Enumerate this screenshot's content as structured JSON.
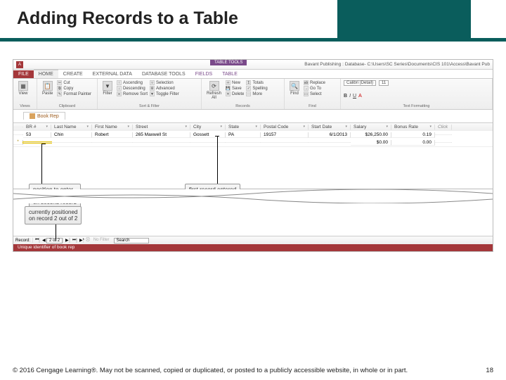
{
  "slide": {
    "title": "Adding Records to a Table"
  },
  "titlebar": {
    "tool_tabs": "TABLE TOOLS",
    "text": "Bavant Publishing : Database- C:\\Users\\SC Series\\Documents\\CIS 101\\Access\\Bavant Pub"
  },
  "tabs": {
    "file": "FILE",
    "home": "HOME",
    "create": "CREATE",
    "external": "EXTERNAL DATA",
    "dbtools": "DATABASE TOOLS",
    "fields": "FIELDS",
    "table": "TABLE"
  },
  "ribbon": {
    "views": {
      "label": "Views",
      "view": "View"
    },
    "clipboard": {
      "label": "Clipboard",
      "paste": "Paste",
      "cut": "Cut",
      "copy": "Copy",
      "fp": "Format Painter"
    },
    "sortfilter": {
      "label": "Sort & Filter",
      "filter": "Filter",
      "asc": "Ascending",
      "desc": "Descending",
      "remove": "Remove Sort",
      "sel": "Selection",
      "adv": "Advanced",
      "toggle": "Toggle Filter"
    },
    "records": {
      "label": "Records",
      "refresh": "Refresh\nAll",
      "new": "New",
      "save": "Save",
      "delete": "Delete",
      "totals": "Totals",
      "spell": "Spelling",
      "more": "More"
    },
    "find": {
      "label": "Find",
      "find": "Find",
      "replace": "Replace",
      "goto": "Go To",
      "select": "Select"
    },
    "textfmt": {
      "label": "Text Formatting",
      "font": "Calibri (Detail)",
      "size": "11"
    }
  },
  "sheet": {
    "tab": "Book Rep",
    "headers": [
      "BR #",
      "Last Name",
      "First Name",
      "Street",
      "City",
      "State",
      "Postal Code",
      "Start Date",
      "Salary",
      "Bonus Rate",
      "Click"
    ],
    "row1": {
      "br": "53",
      "ln": "Chin",
      "fn": "Robert",
      "st": "265 Maxwell St",
      "ci": "Gossett",
      "sta": "PA",
      "pc": "19157",
      "sd": "6/1/2013",
      "sa": "$26,250.00",
      "bo": "0.19"
    },
    "row2": {
      "sa": "$0.00",
      "bo": "0.00"
    }
  },
  "nav": {
    "label": "Record:",
    "pos": "2 of 2",
    "nofilter": "No Filter",
    "search": "Search"
  },
  "status": "Unique identifier of book rep",
  "callouts": {
    "c1": "position to enter\nbook rep number\non second record",
    "c2": "first record entered\nand saved",
    "c3": "currently positioned\non record 2 out of 2"
  },
  "footer": {
    "copy": "© 2016 Cengage Learning®. May not be scanned, copied or duplicated, or posted to a publicly accessible website, in whole or in part.",
    "page": "18"
  }
}
